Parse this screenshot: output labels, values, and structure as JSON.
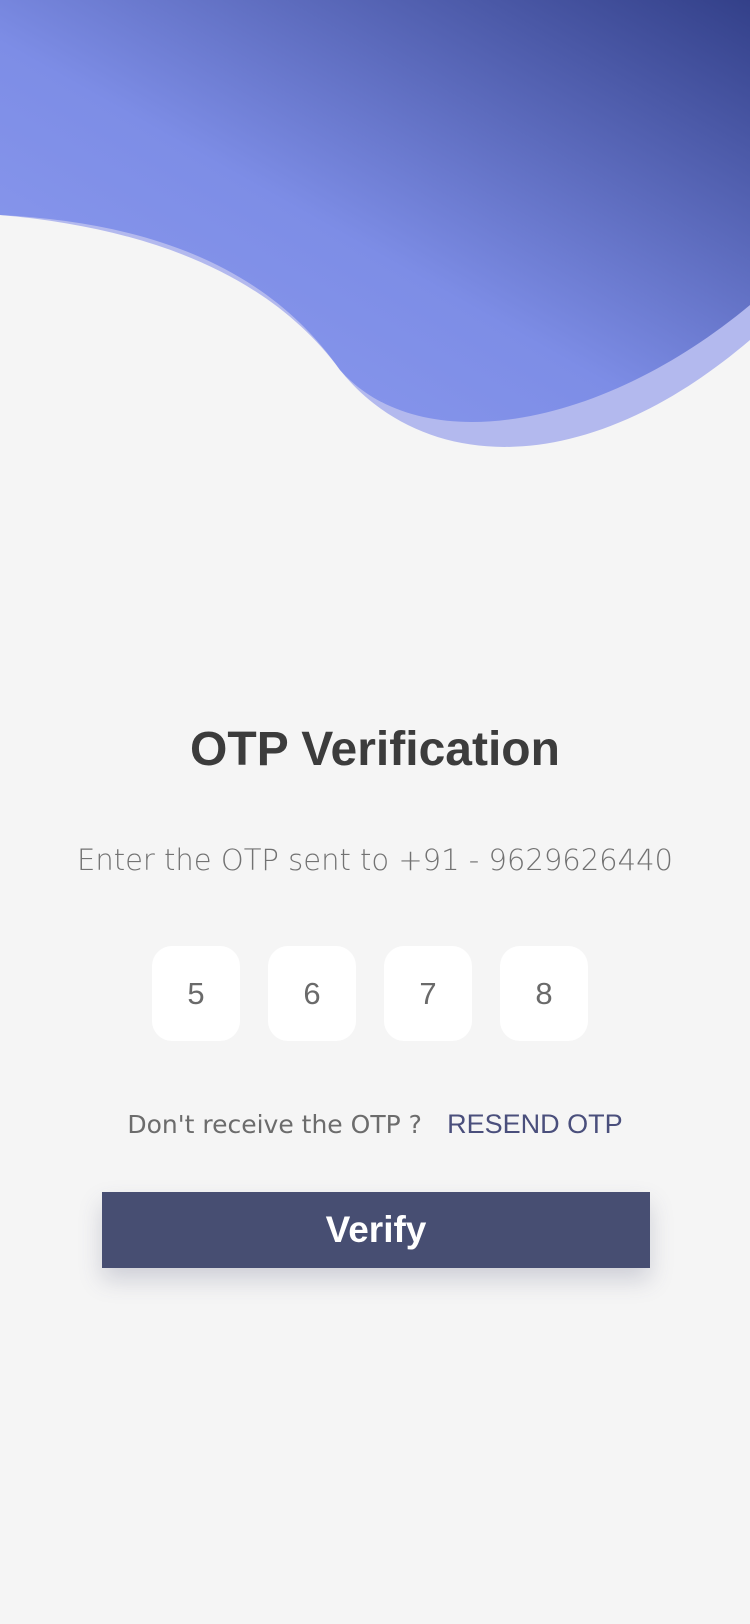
{
  "header": {
    "colors": {
      "gradient_light": "#7d8de6",
      "gradient_dark": "#334089",
      "wave_shadow": "#b3b9ee"
    }
  },
  "page": {
    "title": "OTP Verification",
    "subtitle": "Enter the OTP sent to +91 - 9629626440"
  },
  "otp": {
    "digits": [
      "5",
      "6",
      "7",
      "8"
    ]
  },
  "resend": {
    "prompt": "Don't receive the OTP ?",
    "link_label": "RESEND OTP"
  },
  "verify": {
    "label": "Verify"
  },
  "colors": {
    "background": "#f5f5f5",
    "button": "#474e72",
    "title_text": "#3c3c3c",
    "link": "#4a4f7c"
  }
}
